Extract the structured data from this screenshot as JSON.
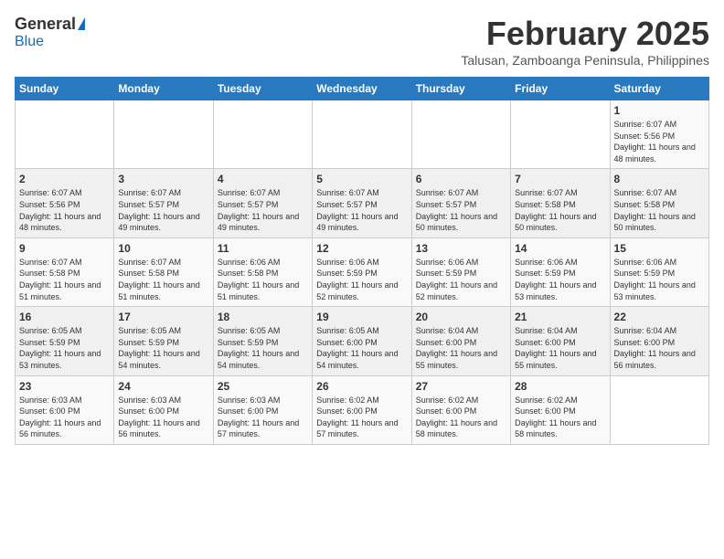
{
  "header": {
    "logo_general": "General",
    "logo_blue": "Blue",
    "month_title": "February 2025",
    "subtitle": "Talusan, Zamboanga Peninsula, Philippines"
  },
  "calendar": {
    "days_of_week": [
      "Sunday",
      "Monday",
      "Tuesday",
      "Wednesday",
      "Thursday",
      "Friday",
      "Saturday"
    ],
    "weeks": [
      [
        {
          "day": "",
          "info": ""
        },
        {
          "day": "",
          "info": ""
        },
        {
          "day": "",
          "info": ""
        },
        {
          "day": "",
          "info": ""
        },
        {
          "day": "",
          "info": ""
        },
        {
          "day": "",
          "info": ""
        },
        {
          "day": "1",
          "info": "Sunrise: 6:07 AM\nSunset: 5:56 PM\nDaylight: 11 hours\nand 48 minutes."
        }
      ],
      [
        {
          "day": "2",
          "info": "Sunrise: 6:07 AM\nSunset: 5:56 PM\nDaylight: 11 hours\nand 48 minutes."
        },
        {
          "day": "3",
          "info": "Sunrise: 6:07 AM\nSunset: 5:57 PM\nDaylight: 11 hours\nand 49 minutes."
        },
        {
          "day": "4",
          "info": "Sunrise: 6:07 AM\nSunset: 5:57 PM\nDaylight: 11 hours\nand 49 minutes."
        },
        {
          "day": "5",
          "info": "Sunrise: 6:07 AM\nSunset: 5:57 PM\nDaylight: 11 hours\nand 49 minutes."
        },
        {
          "day": "6",
          "info": "Sunrise: 6:07 AM\nSunset: 5:57 PM\nDaylight: 11 hours\nand 50 minutes."
        },
        {
          "day": "7",
          "info": "Sunrise: 6:07 AM\nSunset: 5:58 PM\nDaylight: 11 hours\nand 50 minutes."
        },
        {
          "day": "8",
          "info": "Sunrise: 6:07 AM\nSunset: 5:58 PM\nDaylight: 11 hours\nand 50 minutes."
        }
      ],
      [
        {
          "day": "9",
          "info": "Sunrise: 6:07 AM\nSunset: 5:58 PM\nDaylight: 11 hours\nand 51 minutes."
        },
        {
          "day": "10",
          "info": "Sunrise: 6:07 AM\nSunset: 5:58 PM\nDaylight: 11 hours\nand 51 minutes."
        },
        {
          "day": "11",
          "info": "Sunrise: 6:06 AM\nSunset: 5:58 PM\nDaylight: 11 hours\nand 51 minutes."
        },
        {
          "day": "12",
          "info": "Sunrise: 6:06 AM\nSunset: 5:59 PM\nDaylight: 11 hours\nand 52 minutes."
        },
        {
          "day": "13",
          "info": "Sunrise: 6:06 AM\nSunset: 5:59 PM\nDaylight: 11 hours\nand 52 minutes."
        },
        {
          "day": "14",
          "info": "Sunrise: 6:06 AM\nSunset: 5:59 PM\nDaylight: 11 hours\nand 53 minutes."
        },
        {
          "day": "15",
          "info": "Sunrise: 6:06 AM\nSunset: 5:59 PM\nDaylight: 11 hours\nand 53 minutes."
        }
      ],
      [
        {
          "day": "16",
          "info": "Sunrise: 6:05 AM\nSunset: 5:59 PM\nDaylight: 11 hours\nand 53 minutes."
        },
        {
          "day": "17",
          "info": "Sunrise: 6:05 AM\nSunset: 5:59 PM\nDaylight: 11 hours\nand 54 minutes."
        },
        {
          "day": "18",
          "info": "Sunrise: 6:05 AM\nSunset: 5:59 PM\nDaylight: 11 hours\nand 54 minutes."
        },
        {
          "day": "19",
          "info": "Sunrise: 6:05 AM\nSunset: 6:00 PM\nDaylight: 11 hours\nand 54 minutes."
        },
        {
          "day": "20",
          "info": "Sunrise: 6:04 AM\nSunset: 6:00 PM\nDaylight: 11 hours\nand 55 minutes."
        },
        {
          "day": "21",
          "info": "Sunrise: 6:04 AM\nSunset: 6:00 PM\nDaylight: 11 hours\nand 55 minutes."
        },
        {
          "day": "22",
          "info": "Sunrise: 6:04 AM\nSunset: 6:00 PM\nDaylight: 11 hours\nand 56 minutes."
        }
      ],
      [
        {
          "day": "23",
          "info": "Sunrise: 6:03 AM\nSunset: 6:00 PM\nDaylight: 11 hours\nand 56 minutes."
        },
        {
          "day": "24",
          "info": "Sunrise: 6:03 AM\nSunset: 6:00 PM\nDaylight: 11 hours\nand 56 minutes."
        },
        {
          "day": "25",
          "info": "Sunrise: 6:03 AM\nSunset: 6:00 PM\nDaylight: 11 hours\nand 57 minutes."
        },
        {
          "day": "26",
          "info": "Sunrise: 6:02 AM\nSunset: 6:00 PM\nDaylight: 11 hours\nand 57 minutes."
        },
        {
          "day": "27",
          "info": "Sunrise: 6:02 AM\nSunset: 6:00 PM\nDaylight: 11 hours\nand 58 minutes."
        },
        {
          "day": "28",
          "info": "Sunrise: 6:02 AM\nSunset: 6:00 PM\nDaylight: 11 hours\nand 58 minutes."
        },
        {
          "day": "",
          "info": ""
        }
      ]
    ]
  }
}
